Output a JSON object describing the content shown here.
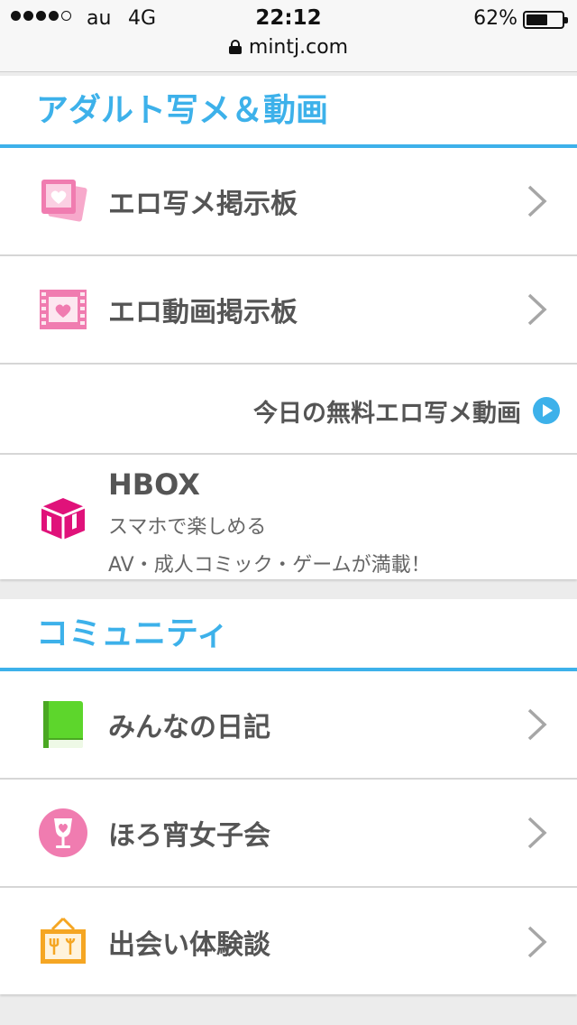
{
  "status_bar": {
    "carrier": "au",
    "network": "4G",
    "time": "22:12",
    "battery_percent": "62%",
    "battery_level": 0.62,
    "signal_bars_filled": 4,
    "signal_bars_total": 5
  },
  "url_bar": {
    "domain": "mintj.com",
    "icon": "lock-icon"
  },
  "colors": {
    "accent": "#3db1ea",
    "pink": "#f07cb0",
    "magenta": "#e0127a",
    "green": "#5dd62c",
    "orange": "#f5a623"
  },
  "adult_section": {
    "title": "アダルト写メ＆動画",
    "items": [
      {
        "label": "エロ写メ掲示板",
        "icon": "photo-heart-icon"
      },
      {
        "label": "エロ動画掲示板",
        "icon": "film-heart-icon"
      }
    ],
    "free_link": {
      "label": "今日の無料エロ写メ動画",
      "icon": "play-circle-icon"
    },
    "hbox": {
      "title": "HBOX",
      "line1": "スマホで楽しめる",
      "line2": "AV・成人コミック・ゲームが満載！",
      "icon": "hbox-logo-icon"
    }
  },
  "community_section": {
    "title": "コミュニティ",
    "items": [
      {
        "label": "みんなの日記",
        "icon": "diary-book-icon"
      },
      {
        "label": "ほろ宵女子会",
        "icon": "wine-glass-heart-icon"
      },
      {
        "label": "出会い体験談",
        "icon": "signboard-icon"
      }
    ]
  }
}
